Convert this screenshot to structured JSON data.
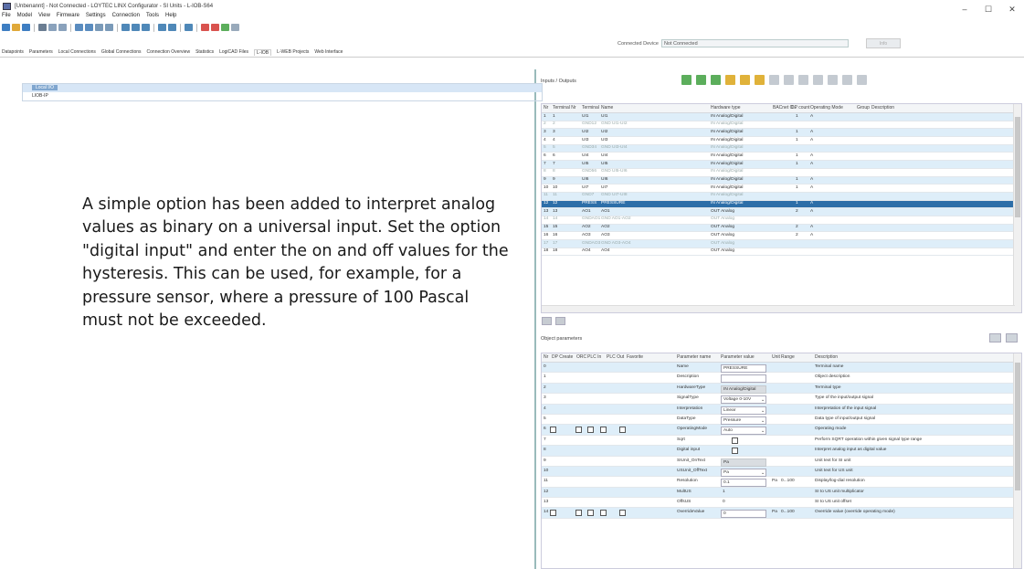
{
  "window": {
    "title": "[Unbenannt] - Not Connected - LOYTEC LINX Configurator - SI Units - L-IOB-S64"
  },
  "window_controls": {
    "minimize": "–",
    "maximize": "☐",
    "close": "✕"
  },
  "menu": [
    "File",
    "Model",
    "View",
    "Firmware",
    "Settings",
    "Connection",
    "Tools",
    "Help"
  ],
  "connection": {
    "label": "Connected Device",
    "value": "Not Connected",
    "info_button": "Info"
  },
  "tabs": [
    "Datapoints",
    "Parameters",
    "Local Connections",
    "Global Connections",
    "Connection Overview",
    "Statistics",
    "LogiCAD Files",
    "L-IOB",
    "L-WEB Projects",
    "Web Interface"
  ],
  "active_tab_index": 7,
  "tree": {
    "selected": "Local I/O",
    "item": "LIOB-IP"
  },
  "caption": "A simple option has been added to interpret analog values as binary on a universal input. Set the option \"digital input\" and enter the on and off values for the hysteresis. This can be used, for example, for a pressure sensor, where a pressure of 100 Pascal must not be exceeded.",
  "io": {
    "title": "Inputs / Outputs",
    "headers": [
      "Nr",
      "Terminal Nr",
      "Terminal",
      "Name",
      "Hardware type",
      "BACnet O...",
      "DP count",
      "Operating Mode",
      "Group",
      "Description"
    ],
    "rows": [
      {
        "nr": "1",
        "tnr": "1",
        "term": "UI1",
        "name": "UI1",
        "hw": "IN Analog/Digital",
        "dp": "1",
        "mode": "A",
        "style": "alt"
      },
      {
        "nr": "2",
        "tnr": "2",
        "term": "GND12",
        "name": "GND UI1-UI2",
        "hw": "IN Analog/Digital",
        "dp": "",
        "mode": "",
        "style": "gray"
      },
      {
        "nr": "3",
        "tnr": "3",
        "term": "UI2",
        "name": "UI2",
        "hw": "IN Analog/Digital",
        "dp": "1",
        "mode": "A",
        "style": "alt"
      },
      {
        "nr": "4",
        "tnr": "4",
        "term": "UI3",
        "name": "UI3",
        "hw": "IN Analog/Digital",
        "dp": "1",
        "mode": "A",
        "style": ""
      },
      {
        "nr": "5",
        "tnr": "5",
        "term": "GND34",
        "name": "GND UI3-UI4",
        "hw": "IN Analog/Digital",
        "dp": "",
        "mode": "",
        "style": "altgray"
      },
      {
        "nr": "6",
        "tnr": "6",
        "term": "UI4",
        "name": "UI4",
        "hw": "IN Analog/Digital",
        "dp": "1",
        "mode": "A",
        "style": ""
      },
      {
        "nr": "7",
        "tnr": "7",
        "term": "UI5",
        "name": "UI5",
        "hw": "IN Analog/Digital",
        "dp": "1",
        "mode": "A",
        "style": "alt"
      },
      {
        "nr": "8",
        "tnr": "8",
        "term": "GND56",
        "name": "GND UI5-UI6",
        "hw": "IN Analog/Digital",
        "dp": "",
        "mode": "",
        "style": "gray"
      },
      {
        "nr": "9",
        "tnr": "9",
        "term": "UI6",
        "name": "UI6",
        "hw": "IN Analog/Digital",
        "dp": "1",
        "mode": "A",
        "style": "alt"
      },
      {
        "nr": "10",
        "tnr": "10",
        "term": "UI7",
        "name": "UI7",
        "hw": "IN Analog/Digital",
        "dp": "1",
        "mode": "A",
        "style": ""
      },
      {
        "nr": "11",
        "tnr": "11",
        "term": "GND7",
        "name": "GND UI7-UI8",
        "hw": "IN Analog/Digital",
        "dp": "",
        "mode": "",
        "style": "altgray"
      },
      {
        "nr": "12",
        "tnr": "12",
        "term": "PRESS",
        "name": "PRESSURE",
        "hw": "IN Analog/Digital",
        "dp": "1",
        "mode": "A",
        "style": "sel"
      },
      {
        "nr": "13",
        "tnr": "13",
        "term": "AO1",
        "name": "AO1",
        "hw": "OUT Analog",
        "dp": "2",
        "mode": "A",
        "style": "alt"
      },
      {
        "nr": "14",
        "tnr": "14",
        "term": "GNDAO1",
        "name": "GND AO1-AO2",
        "hw": "OUT Analog",
        "dp": "",
        "mode": "",
        "style": "gray"
      },
      {
        "nr": "15",
        "tnr": "15",
        "term": "AO2",
        "name": "AO2",
        "hw": "OUT Analog",
        "dp": "2",
        "mode": "A",
        "style": "alt"
      },
      {
        "nr": "16",
        "tnr": "16",
        "term": "AO3",
        "name": "AO3",
        "hw": "OUT Analog",
        "dp": "2",
        "mode": "A",
        "style": ""
      },
      {
        "nr": "17",
        "tnr": "17",
        "term": "GNDAO3",
        "name": "GND AO3-AO4",
        "hw": "OUT Analog",
        "dp": "",
        "mode": "",
        "style": "altgray"
      },
      {
        "nr": "18",
        "tnr": "18",
        "term": "AO4",
        "name": "AO4",
        "hw": "OUT Analog",
        "dp": "",
        "mode": "",
        "style": ""
      }
    ]
  },
  "params": {
    "title": "Object parameters",
    "headers": [
      "Nr",
      "DP Create",
      "ORC",
      "PLC In",
      "PLC Out",
      "Favorite",
      "Parameter name",
      "Parameter value",
      "Unit",
      "Range",
      "Description"
    ],
    "rows": [
      {
        "nr": "0",
        "name": "Name",
        "value": "PRESSURE",
        "unit": "",
        "range": "",
        "desc": "Terminal name",
        "box": "input",
        "checks": false
      },
      {
        "nr": "1",
        "name": "Description",
        "value": "",
        "unit": "",
        "range": "",
        "desc": "Object description",
        "box": "input",
        "checks": false
      },
      {
        "nr": "2",
        "name": "HardwareType",
        "value": "IN Analog/Digital",
        "unit": "",
        "range": "",
        "desc": "Terminal type",
        "box": "dis",
        "checks": false
      },
      {
        "nr": "3",
        "name": "SignalType",
        "value": "Voltage 0-10V",
        "unit": "",
        "range": "",
        "desc": "Type of the input/output signal",
        "box": "dd",
        "checks": false
      },
      {
        "nr": "4",
        "name": "Interpretation",
        "value": "Linear",
        "unit": "",
        "range": "",
        "desc": "Interpretation of the input signal",
        "box": "dd",
        "checks": false
      },
      {
        "nr": "5",
        "name": "DataType",
        "value": "Pressure",
        "unit": "",
        "range": "",
        "desc": "Data type of input/output signal",
        "box": "dd",
        "checks": false
      },
      {
        "nr": "6",
        "name": "OperatingMode",
        "value": "Auto",
        "unit": "",
        "range": "",
        "desc": "Operating mode",
        "box": "dd",
        "checks": true
      },
      {
        "nr": "7",
        "name": "Sqrt",
        "value": "",
        "unit": "",
        "range": "",
        "desc": "Perform SQRT operation within given signal type range",
        "box": "check",
        "checks": false
      },
      {
        "nr": "8",
        "name": "Digital input",
        "value": "",
        "unit": "",
        "range": "",
        "desc": "Interpret analog input as digital value",
        "box": "check",
        "checks": false
      },
      {
        "nr": "9",
        "name": "SIUnit_OnText",
        "value": "Pa",
        "unit": "",
        "range": "",
        "desc": "Unit text for SI unit",
        "box": "dis",
        "checks": false
      },
      {
        "nr": "10",
        "name": "USUnit_OffText",
        "value": "Pa",
        "unit": "",
        "range": "",
        "desc": "Unit text for US unit",
        "box": "dd",
        "checks": false
      },
      {
        "nr": "11",
        "name": "Resolution",
        "value": "0.1",
        "unit": "Pa",
        "range": "0...100",
        "desc": "Display/log-dial resolution",
        "box": "input",
        "checks": false
      },
      {
        "nr": "12",
        "name": "MultUS",
        "value": "1",
        "unit": "",
        "range": "",
        "desc": "SI to US unit multiplicator",
        "box": "none",
        "checks": false
      },
      {
        "nr": "13",
        "name": "OffsUS",
        "value": "0",
        "unit": "",
        "range": "",
        "desc": "SI to US unit offset",
        "box": "none",
        "checks": false
      },
      {
        "nr": "14",
        "name": "OverrideValue",
        "value": "0",
        "unit": "Pa",
        "range": "0...100",
        "desc": "Override value (override operating mode)",
        "box": "input",
        "checks": true
      }
    ]
  },
  "colors": {
    "selected_row": "#2d6ea8",
    "alt_row": "#deeef9"
  }
}
